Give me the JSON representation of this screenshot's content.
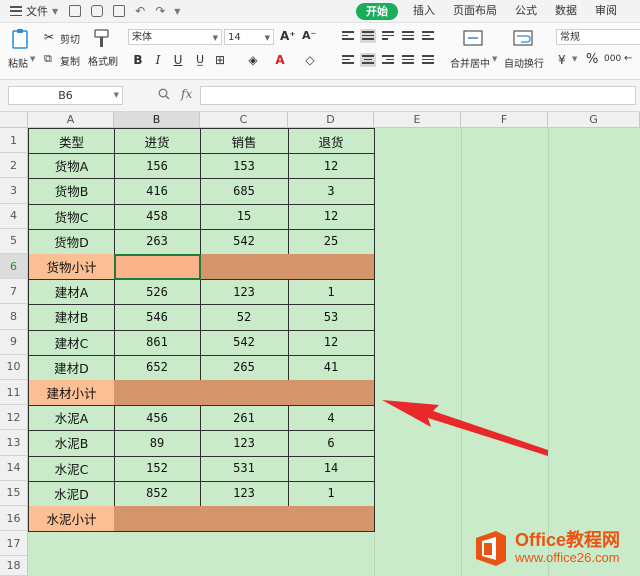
{
  "titlebar": {
    "file_label": "文件",
    "tabs": [
      {
        "label": "开始",
        "active": true
      },
      {
        "label": "插入",
        "active": false
      },
      {
        "label": "页面布局",
        "active": false
      },
      {
        "label": "公式",
        "active": false
      },
      {
        "label": "数据",
        "active": false
      },
      {
        "label": "审阅",
        "active": false
      }
    ]
  },
  "ribbon": {
    "paste_label": "粘贴",
    "cut_label": "剪切",
    "copy_label": "复制",
    "format_painter_label": "格式刷",
    "font_name": "宋体",
    "font_size": "14",
    "merge_label": "合并居中",
    "wrap_label": "自动换行",
    "number_format": "常规",
    "bold": "B",
    "italic": "I",
    "underline": "U",
    "font_color_glyph": "A",
    "accent_color": "#1aad5b",
    "font_color": "#e02020"
  },
  "formula_bar": {
    "cell_ref": "B6",
    "fx_label": "fx",
    "formula": ""
  },
  "sheet": {
    "columns": [
      "A",
      "B",
      "C",
      "D",
      "E",
      "F",
      "G"
    ],
    "selected_column": "B",
    "selected_row": 6,
    "rows": [
      {
        "n": "1",
        "cells": [
          "类型",
          "进货",
          "销售",
          "退货"
        ],
        "kind": "header"
      },
      {
        "n": "2",
        "cells": [
          "货物A",
          "156",
          "153",
          "12"
        ],
        "kind": "data"
      },
      {
        "n": "3",
        "cells": [
          "货物B",
          "416",
          "685",
          "3"
        ],
        "kind": "data"
      },
      {
        "n": "4",
        "cells": [
          "货物C",
          "458",
          "15",
          "12"
        ],
        "kind": "data"
      },
      {
        "n": "5",
        "cells": [
          "货物D",
          "263",
          "542",
          "25"
        ],
        "kind": "data"
      },
      {
        "n": "6",
        "cells": [
          "货物小计",
          "",
          "",
          ""
        ],
        "kind": "subtotal"
      },
      {
        "n": "7",
        "cells": [
          "建材A",
          "526",
          "123",
          "1"
        ],
        "kind": "data"
      },
      {
        "n": "8",
        "cells": [
          "建材B",
          "546",
          "52",
          "53"
        ],
        "kind": "data"
      },
      {
        "n": "9",
        "cells": [
          "建材C",
          "861",
          "542",
          "12"
        ],
        "kind": "data"
      },
      {
        "n": "10",
        "cells": [
          "建材D",
          "652",
          "265",
          "41"
        ],
        "kind": "data"
      },
      {
        "n": "11",
        "cells": [
          "建材小计",
          "",
          "",
          ""
        ],
        "kind": "subtotal"
      },
      {
        "n": "12",
        "cells": [
          "水泥A",
          "456",
          "261",
          "4"
        ],
        "kind": "data"
      },
      {
        "n": "13",
        "cells": [
          "水泥B",
          "89",
          "123",
          "6"
        ],
        "kind": "data"
      },
      {
        "n": "14",
        "cells": [
          "水泥C",
          "152",
          "531",
          "14"
        ],
        "kind": "data"
      },
      {
        "n": "15",
        "cells": [
          "水泥D",
          "852",
          "123",
          "1"
        ],
        "kind": "data"
      },
      {
        "n": "16",
        "cells": [
          "水泥小计",
          "",
          "",
          ""
        ],
        "kind": "subtotal"
      },
      {
        "n": "17",
        "cells": [
          "",
          "",
          "",
          ""
        ],
        "kind": "empty"
      },
      {
        "n": "18",
        "cells": [
          "",
          "",
          "",
          ""
        ],
        "kind": "empty"
      }
    ]
  },
  "watermark": {
    "brand": "Office教程网",
    "url": "www.office26.com"
  },
  "colors": {
    "grid_background": "#c9ebc9",
    "subtotal_label": "#fbbf93",
    "subtotal_fill": "#d4956b",
    "arrow": "#e8282b",
    "logo": "#ea5412"
  }
}
